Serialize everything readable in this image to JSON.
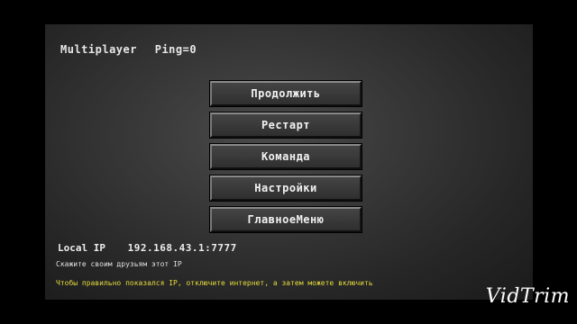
{
  "status": {
    "mode": "Multiplayer",
    "ping": "Ping=0"
  },
  "menu": {
    "items": [
      {
        "label": "Продолжить"
      },
      {
        "label": "Рестарт"
      },
      {
        "label": "Команда"
      },
      {
        "label": "Настройки"
      },
      {
        "label": "ГлавноеМеню"
      }
    ]
  },
  "network": {
    "ip_label": "Local IP",
    "ip_value": "192.168.43.1:7777",
    "share_hint": "Скажите своим друзьям этот IP",
    "warning": "Чтобы правильно показался IP, отключите интернет, а затем можете включить"
  },
  "watermark": {
    "text": "VidTrim"
  },
  "colors": {
    "warning": "#e6dc3c",
    "text": "#e8e8e8",
    "button": "#3a3a3a"
  }
}
